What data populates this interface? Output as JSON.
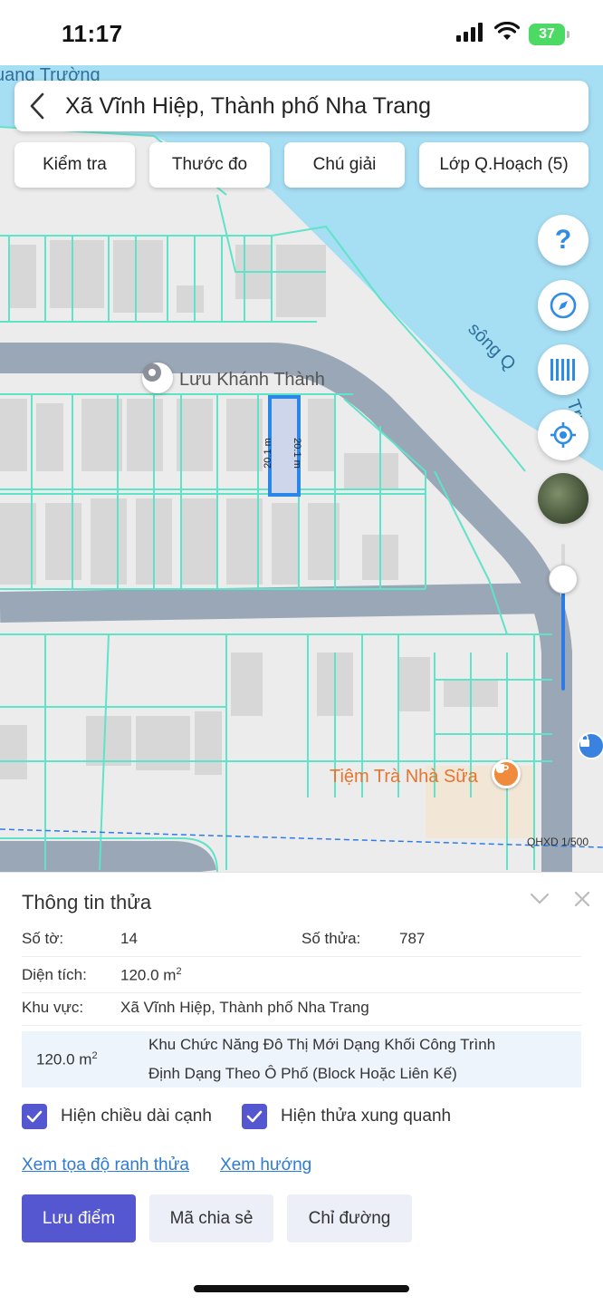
{
  "status_bar": {
    "time": "11:17",
    "battery": "37"
  },
  "search": {
    "title": "Xã Vĩnh Hiệp, Thành phố Nha Trang"
  },
  "tools": [
    {
      "label": "Kiểm tra"
    },
    {
      "label": "Thước đo"
    },
    {
      "label": "Chú giải"
    },
    {
      "label": "Lớp Q.Hoạch (5)"
    }
  ],
  "map": {
    "labels": {
      "place_name": "Lưu Khánh Thành",
      "cafe_name": "Tiệm Trà Nhà Sữa",
      "river": "sông Q",
      "river_tail": "Trư",
      "top_partial": "uang Trường",
      "edge_top": "20.1 m",
      "edge_side": "20.1 m",
      "scale": "QHXD 1/500"
    },
    "zoom_level": 0.86,
    "colors": {
      "parcel_lines": "#5fe3c9",
      "selected_parcel": "#2a86e8",
      "water": "#a6def4",
      "road": "#9aa7b6"
    }
  },
  "controls": [
    {
      "icon": "help-icon"
    },
    {
      "icon": "compass-icon"
    },
    {
      "icon": "barcode-icon"
    },
    {
      "icon": "locate-icon"
    },
    {
      "icon": "satellite-thumbnail"
    }
  ],
  "parcel": {
    "title": "Thông tin thửa",
    "sheet_label": "Số tờ:",
    "sheet_value": "14",
    "plot_label": "Số thửa:",
    "plot_value": "787",
    "area_label": "Diện tích:",
    "area_value": "120.0 m",
    "area_unit_sup": "2",
    "region_label": "Khu vực:",
    "region_value": "Xã Vĩnh Hiệp, Thành phố Nha Trang",
    "zone_area": "120.0 m",
    "zone_area_sup": "2",
    "zone_line1": "Khu Chức Năng Đô Thị Mới Dạng Khối Công Trình",
    "zone_line2": "Định Dạng Theo Ô Phố (Block Hoặc Liên Kế)"
  },
  "options": {
    "show_edge_length": "Hiện chiều dài cạnh",
    "show_neighbors": "Hiện thửa xung quanh"
  },
  "links": {
    "coords": "Xem tọa độ ranh thửa",
    "direction": "Xem hướng"
  },
  "actions": {
    "save": "Lưu điểm",
    "share": "Mã chia sẻ",
    "route": "Chỉ đường"
  },
  "accent": "#5457cf"
}
